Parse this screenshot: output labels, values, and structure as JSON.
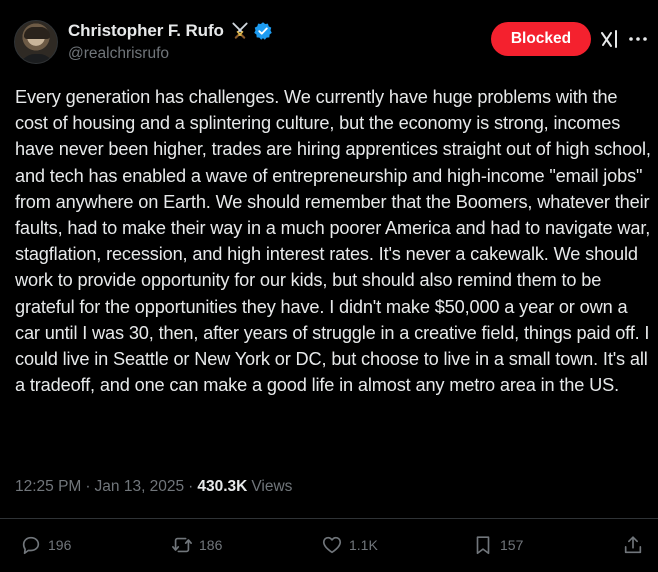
{
  "author": {
    "display_name": "Christopher F. Rufo",
    "handle": "@realchrisrufo",
    "badge_icon": "crossed-swords-icon",
    "verified_icon": "verified-badge-icon"
  },
  "header": {
    "blocked_label": "Blocked"
  },
  "tweet": {
    "text": "Every generation has challenges. We currently have huge problems with the cost of housing and a splintering culture, but the economy is strong, incomes have never been higher, trades are hiring apprentices straight out of high school, and tech has enabled a wave of entrepreneurship and high-income \"email jobs\" from anywhere on Earth. We should remember that the Boomers, whatever their faults, had to make their way in a much poorer America and had to navigate war, stagflation, recession, and high interest rates. It's never a cakewalk. We should work to provide opportunity for our kids, but should also remind them to be grateful for the opportunities they have. I didn't make $50,000 a year or own a car until I was 30, then, after years of struggle in a creative field, things paid off. I could live in Seattle or New York or DC, but choose to live in a small town. It's all a tradeoff, and one can make a good life in almost any metro area in the US.",
    "time": "12:25 PM",
    "date": "Jan 13, 2025",
    "views_count": "430.3K",
    "views_label": "Views"
  },
  "actions": {
    "replies": "196",
    "reposts": "186",
    "likes": "1.1K",
    "bookmarks": "157"
  },
  "colors": {
    "background": "#000000",
    "text": "#e7e9ea",
    "secondary": "#71767b",
    "blocked": "#f4212e",
    "verified": "#1d9bf0"
  }
}
